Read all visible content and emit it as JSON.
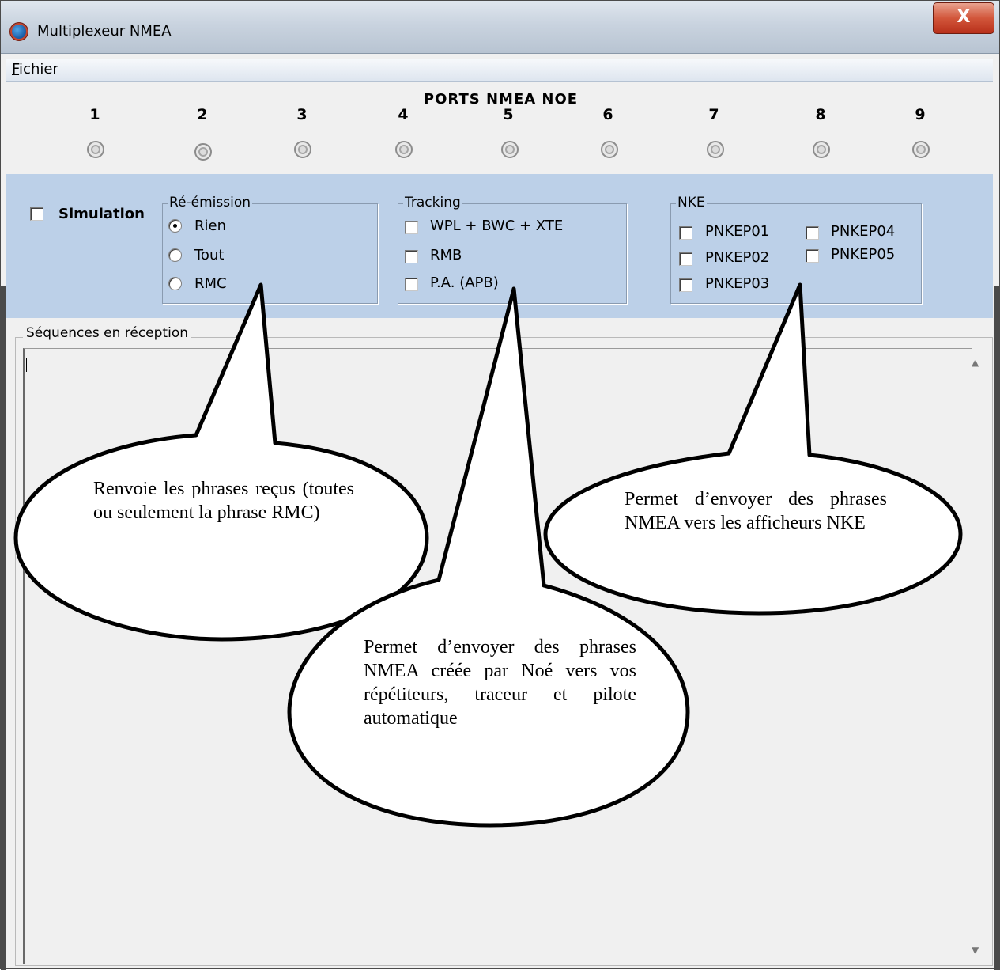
{
  "window": {
    "title": "Multiplexeur NMEA",
    "close_glyph": "X"
  },
  "menu": {
    "file_accel": "F",
    "file_rest": "ichier"
  },
  "ports": {
    "title": "PORTS NMEA NOE",
    "numbers": [
      "1",
      "2",
      "3",
      "4",
      "5",
      "6",
      "7",
      "8",
      "9"
    ]
  },
  "simulation": {
    "label": "Simulation",
    "checked": false
  },
  "reemission": {
    "legend": "Ré-émission",
    "options": [
      {
        "label": "Rien",
        "selected": true
      },
      {
        "label": "Tout",
        "selected": false
      },
      {
        "label": "RMC",
        "selected": false
      }
    ]
  },
  "tracking": {
    "legend": "Tracking",
    "options": [
      {
        "label": "WPL + BWC + XTE",
        "checked": false
      },
      {
        "label": "RMB",
        "checked": false
      },
      {
        "label": "P.A. (APB)",
        "checked": false
      }
    ]
  },
  "nke": {
    "legend": "NKE",
    "options": [
      {
        "label": "PNKEP01",
        "checked": false
      },
      {
        "label": "PNKEP02",
        "checked": false
      },
      {
        "label": "PNKEP03",
        "checked": false
      },
      {
        "label": "PNKEP04",
        "checked": false
      },
      {
        "label": "PNKEP05",
        "checked": false
      }
    ]
  },
  "reception": {
    "legend": "Séquences en réception",
    "content": ""
  },
  "callouts": {
    "reemission": "Renvoie les phrases reçus (toutes ou seulement la phrase RMC)",
    "tracking": "Permet d’envoyer des phrases NMEA créée par Noé vers vos répétiteurs, traceur et pilote automatique",
    "nke": "Permet d’envoyer des phrases NMEA vers les afficheurs NKE"
  },
  "icons": {
    "app": "globe-icon",
    "close": "close-icon",
    "port_led": "port-led-icon",
    "scroll_up": "scroll-up-arrow-icon",
    "scroll_down": "scroll-down-arrow-icon"
  }
}
